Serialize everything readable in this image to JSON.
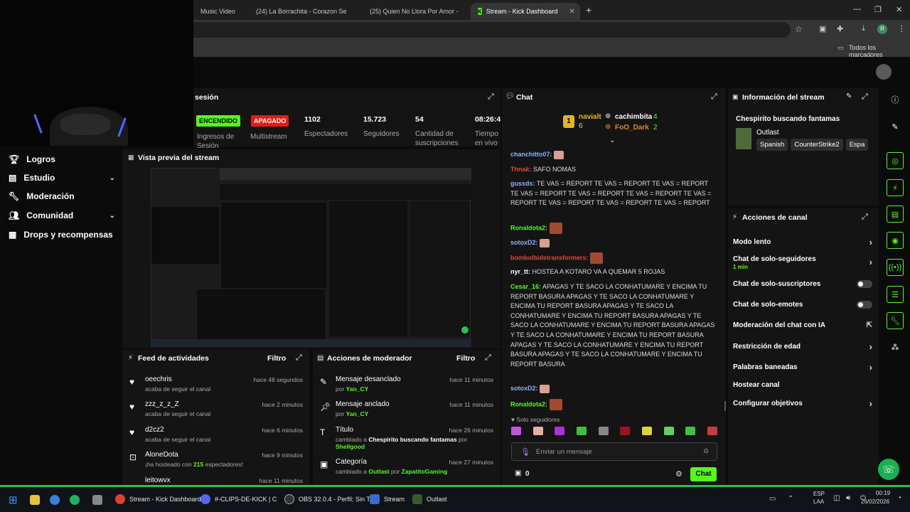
{
  "browser": {
    "tabs": [
      {
        "label": "Music Video",
        "icon": "youtube-icon"
      },
      {
        "label": "(24) La Borrachita - Corazon Se",
        "icon": "youtube-icon"
      },
      {
        "label": "(25) Quien No Llora Por Amor -",
        "icon": "youtube-icon"
      },
      {
        "label": "Stream - Kick Dashboard",
        "icon": "kick-icon"
      }
    ],
    "new_tab": "+",
    "bookmarks_label": "Todos los marcadores"
  },
  "sidebar": {
    "items": [
      {
        "label": "Logros",
        "icon": "trophy-icon"
      },
      {
        "label": "Estudio",
        "icon": "studio-icon"
      },
      {
        "label": "Moderación",
        "icon": "wrench-icon"
      },
      {
        "label": "Comunidad",
        "icon": "people-icon"
      },
      {
        "label": "Drops y recompensas",
        "icon": "gift-icon"
      }
    ]
  },
  "session": {
    "title": "sesión",
    "status_on": "ENCENDIDO",
    "status_off": "APAGADO",
    "stats": [
      {
        "value": "",
        "label": "Ingresos de Sesión"
      },
      {
        "value": "",
        "label": "Multistream"
      },
      {
        "value": "1102",
        "label": "Espectadores"
      },
      {
        "value": "15.723",
        "label": "Seguidores"
      },
      {
        "value": "54",
        "label": "Cantidad de suscripciones"
      },
      {
        "value": "08:26:4",
        "label": "Tiempo en vivo"
      }
    ]
  },
  "preview": {
    "title": "Vista previa del stream"
  },
  "activity": {
    "title": "Feed de actividades",
    "filter": "Filtro",
    "items": [
      {
        "name": "oeechris",
        "detail": "acaba de seguir el canal",
        "time": "hace 48 segundos",
        "icon": "heart-icon"
      },
      {
        "name": "zzz_z_z_Z",
        "detail": "acaba de seguir el canal",
        "time": "hace 2 minutos",
        "icon": "heart-icon"
      },
      {
        "name": "d2cz2",
        "detail": "acaba de seguir el canal",
        "time": "hace 6 minutos",
        "icon": "heart-icon"
      },
      {
        "name": "AloneDota",
        "detail_pre": "¡ha hosteado con",
        "detail_num": "215",
        "detail_post": "espectadores!",
        "time": "hace 9 minutos",
        "icon": "host-icon"
      },
      {
        "name": "leitowvx",
        "detail": "",
        "time": "hace 11 minutos",
        "icon": "heart-icon"
      }
    ]
  },
  "modactions": {
    "title": "Acciones de moderador",
    "filter": "Filtro",
    "items": [
      {
        "title": "Mensaje desanclado",
        "by": "por",
        "user": "Yan_CY",
        "time": "hace 11 minutos",
        "icon": "unpin-icon"
      },
      {
        "title": "Mensaje anclado",
        "by": "por",
        "user": "Yan_CY",
        "time": "hace 11 minutos",
        "icon": "pin-icon"
      },
      {
        "title": "Título",
        "changed": "cambiado a",
        "value": "Chespirito buscando fantamas",
        "by": "por",
        "user": "Shellgood",
        "time": "hace 26 minutos",
        "icon": "title-icon"
      },
      {
        "title": "Categoría",
        "changed": "cambiado a",
        "value": "Outlast",
        "by": "por",
        "user": "ZapatitoGaming",
        "time": "hace 27 minutos",
        "icon": "category-icon"
      }
    ]
  },
  "chat": {
    "title": "Chat",
    "pinned_users": [
      {
        "name": "navialt",
        "count": "6",
        "rank": "1"
      },
      {
        "name": "cachimbita",
        "count": "4"
      },
      {
        "name": "FoO_Dark",
        "count": "2"
      }
    ],
    "messages": [
      {
        "user": "chanchitto07:",
        "text": "",
        "color": "#8fb0ff"
      },
      {
        "user": "Thnak:",
        "text": "SAFO NOMAS",
        "color": "#e2453a"
      },
      {
        "user": "gussds:",
        "text": "TE VAS = REPORT  TE VAS = REPORT  TE VAS = REPORT  TE VAS = REPORT  TE VAS = REPORT  TE VAS = REPORT  TE VAS = REPORT  TE VAS = REPORT  TE VAS = REPORT  TE VAS = REPORT",
        "color": "#8fb0ff"
      },
      {
        "user": "Ronaldota2:",
        "text": "",
        "color": "#53fc18"
      },
      {
        "user": "sotoxD2:",
        "text": "",
        "color": "#8fb0ff"
      },
      {
        "user": "bombolbidetransformers:",
        "text": "",
        "color": "#e2453a"
      },
      {
        "user": "nyr_tt:",
        "text": "HOSTEA A KOTARO VA A QUEMAR 5 ROJAS",
        "color": "#ffffff"
      },
      {
        "user": "Cesar_16:",
        "text": "APAGAS Y TE SACO LA CONHATUMARE Y ENCIMA TU REPORT BASURA APAGAS Y TE SACO LA CONHATUMARE Y ENCIMA TU REPORT BASURA APAGAS Y TE SACO LA CONHATUMARE Y ENCIMA TU REPORT BASURA APAGAS Y TE SACO LA CONHATUMARE Y ENCIMA TU REPORT BASURA APAGAS Y TE SACO LA CONHATUMARE Y ENCIMA TU REPORT BASURA APAGAS Y TE SACO LA CONHATUMARE Y ENCIMA TU REPORT BASURA APAGAS Y TE SACO LA CONHATUMARE Y ENCIMA TU REPORT BASURA",
        "color": "#53fc18"
      },
      {
        "user": "sotoxD2:",
        "text": "",
        "color": "#8fb0ff"
      },
      {
        "user": "Ronaldota2:",
        "text": "",
        "color": "#53fc18"
      }
    ],
    "followers_only": "Solo seguidores",
    "input_placeholder": "Enviar un mensaje",
    "points": "0",
    "send_label": "Chat"
  },
  "stream_info": {
    "title": "Información del stream",
    "stream_title": "Chespirito buscando fantamas",
    "category": "Outlast",
    "tags": [
      "Spanish",
      "CounterStrike2",
      "Espa"
    ]
  },
  "channel_actions": {
    "title": "Acciones de canal",
    "items": [
      {
        "label": "Modo lento",
        "control": "arrow"
      },
      {
        "label": "Chat de solo-seguidores",
        "sub": "1 min",
        "control": "arrow"
      },
      {
        "label": "Chat de solo-suscriptores",
        "control": "toggle"
      },
      {
        "label": "Chat de solo-emotes",
        "control": "toggle"
      },
      {
        "label": "Moderación del chat con IA",
        "control": "external"
      },
      {
        "label": "Restricción de edad",
        "control": "arrow"
      },
      {
        "label": "Palabras baneadas",
        "control": "arrow"
      },
      {
        "label": "Hostear canal",
        "control": "none"
      },
      {
        "label": "Configurar objetivos",
        "control": "arrow"
      }
    ]
  },
  "taskbar": {
    "apps": [
      {
        "label": "Stream - Kick Dashboard",
        "icon": "chrome-icon"
      },
      {
        "label": "#-CLIPS-DE-KICK | C",
        "icon": "discord-icon"
      },
      {
        "label": "OBS 32.0.4 - Perfil: Sin T",
        "icon": "obs-icon"
      },
      {
        "label": "Stream",
        "icon": "stream-icon"
      },
      {
        "label": "Outlast",
        "icon": "outlast-icon"
      }
    ],
    "lang": "ESP",
    "lang2": "LAA",
    "time": "00:19",
    "date": "26/02/2026"
  }
}
